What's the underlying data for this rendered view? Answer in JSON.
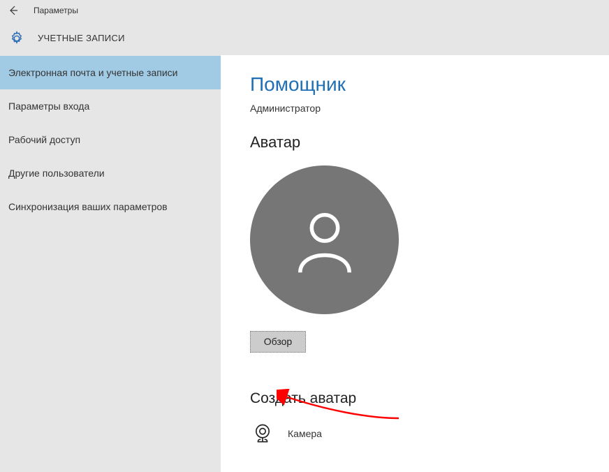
{
  "titlebar": {
    "title": "Параметры"
  },
  "page": {
    "header_title": "УЧЕТНЫЕ ЗАПИСИ"
  },
  "sidebar": {
    "items": [
      {
        "label": "Электронная почта и учетные записи",
        "selected": true
      },
      {
        "label": "Параметры входа",
        "selected": false
      },
      {
        "label": "Рабочий доступ",
        "selected": false
      },
      {
        "label": "Другие пользователи",
        "selected": false
      },
      {
        "label": "Синхронизация ваших параметров",
        "selected": false
      }
    ]
  },
  "content": {
    "username": "Помощник",
    "role": "Администратор",
    "avatar_section_title": "Аватар",
    "browse_button_label": "Обзор",
    "create_avatar_title": "Создать аватар",
    "camera_label": "Камера"
  },
  "colors": {
    "accent": "#1f6fb5",
    "selected_bg": "#a1cbe5",
    "sidebar_bg": "#e6e6e6",
    "avatar_bg": "#767676",
    "button_bg": "#cccccc",
    "annotation": "#ff0000"
  }
}
